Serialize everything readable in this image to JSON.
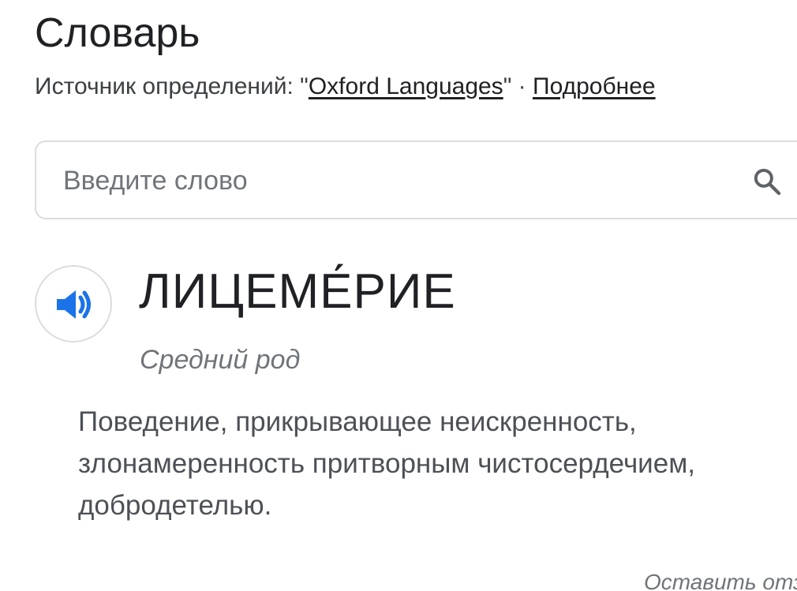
{
  "dictionary": {
    "title": "Словарь",
    "source_prefix": "Источник определений: \"",
    "source_link": "Oxford Languages",
    "source_suffix": "\" · ",
    "more_link": "Подробнее"
  },
  "search": {
    "placeholder": "Введите слово",
    "value": ""
  },
  "entry": {
    "headword": "ЛИЦЕМЕ́РИЕ",
    "part_of_speech": "Средний род",
    "definition": "Поведение, прикрывающее неискренность, злонамеренность притворным чистосердечием, добродетелью."
  },
  "footer": {
    "feedback": "Оставить отзыв"
  },
  "colors": {
    "accent_blue": "#1a73e8",
    "border": "#dadce0"
  },
  "icons": {
    "search": "search-icon",
    "audio": "speaker-icon"
  }
}
